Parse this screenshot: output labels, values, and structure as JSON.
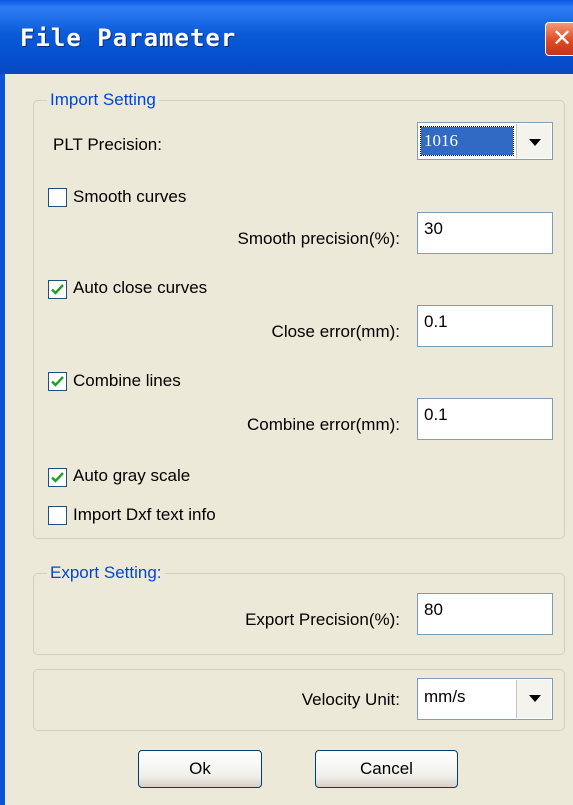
{
  "window": {
    "title": "File Parameter",
    "close_symbol": "✕"
  },
  "import_setting": {
    "legend": "Import Setting",
    "plt_precision_label": "PLT Precision:",
    "plt_precision_value": "1016",
    "smooth_curves": {
      "label": "Smooth curves",
      "checked": false
    },
    "smooth_precision_label": "Smooth precision(%):",
    "smooth_precision_value": "30",
    "auto_close_curves": {
      "label": "Auto close curves",
      "checked": true
    },
    "close_error_label": "Close error(mm):",
    "close_error_value": "0.1",
    "combine_lines": {
      "label": "Combine lines",
      "checked": true
    },
    "combine_error_label": "Combine error(mm):",
    "combine_error_value": "0.1",
    "auto_gray_scale": {
      "label": "Auto gray scale",
      "checked": true
    },
    "import_dxf_text": {
      "label": "Import Dxf text info",
      "checked": false
    }
  },
  "export_setting": {
    "legend": "Export Setting:",
    "export_precision_label": "Export Precision(%):",
    "export_precision_value": "80"
  },
  "velocity": {
    "label": "Velocity Unit:",
    "value": "mm/s"
  },
  "buttons": {
    "ok": "Ok",
    "cancel": "Cancel"
  },
  "colors": {
    "title_bar": "#0b5bd8",
    "legend_text": "#0046d5",
    "check_mark": "#21a121",
    "dialog_bg": "#ece9d8"
  },
  "icons": {
    "close": "close-icon",
    "dropdown": "chevron-down-icon",
    "check": "check-icon"
  }
}
